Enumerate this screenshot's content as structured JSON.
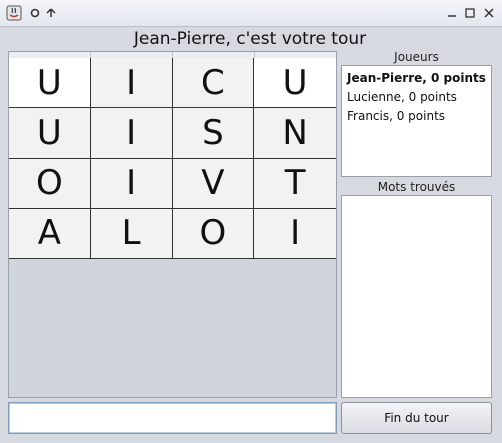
{
  "window": {
    "title": "",
    "title_icons": [
      "java-app-icon",
      "circle-icon",
      "up-arrow-icon"
    ],
    "controls": [
      "minimize-icon",
      "maximize-icon",
      "close-icon"
    ]
  },
  "heading": "Jean-Pierre, c'est votre tour",
  "board": {
    "rows": [
      [
        "U",
        "I",
        "C",
        "U"
      ],
      [
        "U",
        "I",
        "S",
        "N"
      ],
      [
        "O",
        "I",
        "V",
        "T"
      ],
      [
        "A",
        "L",
        "O",
        "I"
      ]
    ]
  },
  "players_panel": {
    "label": "Joueurs",
    "players": [
      {
        "text": "Jean-Pierre, 0 points",
        "current": true
      },
      {
        "text": "Lucienne, 0 points",
        "current": false
      },
      {
        "text": "Francis, 0 points",
        "current": false
      }
    ]
  },
  "words_panel": {
    "label": "Mots trouvés",
    "words": []
  },
  "input": {
    "value": "",
    "placeholder": ""
  },
  "end_turn_button": "Fin du tour"
}
